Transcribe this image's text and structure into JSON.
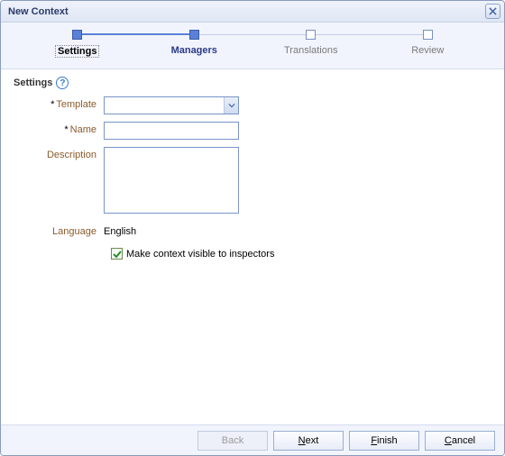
{
  "dialog": {
    "title": "New Context"
  },
  "steps": {
    "settings": "Settings",
    "managers": "Managers",
    "translations": "Translations",
    "review": "Review"
  },
  "section": {
    "heading": "Settings",
    "help_tooltip": "?"
  },
  "form": {
    "template_label": "Template",
    "template_value": "",
    "name_label": "Name",
    "name_value": "",
    "description_label": "Description",
    "description_value": "",
    "language_label": "Language",
    "language_value": "English",
    "visible_label": "Make context visible to inspectors",
    "visible_checked": true
  },
  "buttons": {
    "back": "Back",
    "next_pre": "",
    "next_m": "N",
    "next_post": "ext",
    "finish_pre": "",
    "finish_m": "F",
    "finish_post": "inish",
    "cancel_pre": "",
    "cancel_m": "C",
    "cancel_post": "ancel"
  }
}
